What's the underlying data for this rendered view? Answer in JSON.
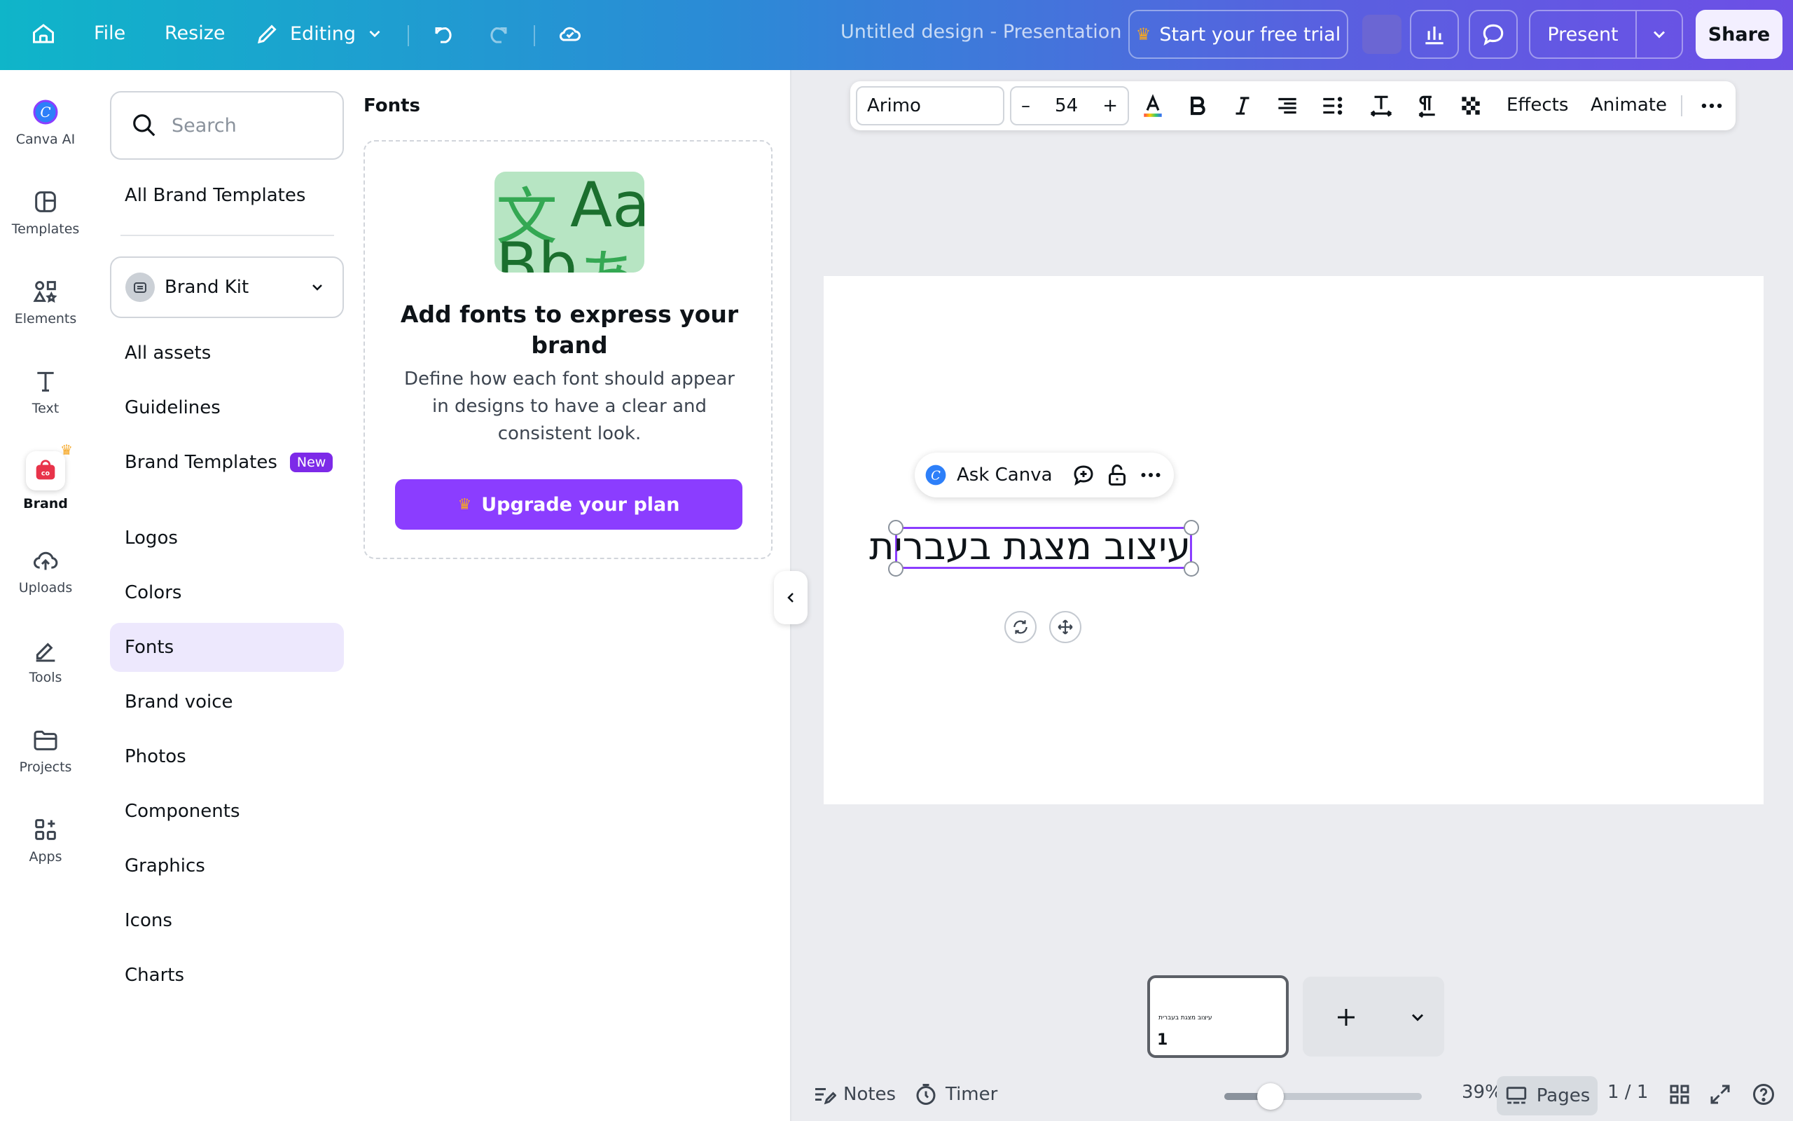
{
  "topbar": {
    "file": "File",
    "resize": "Resize",
    "editing": "Editing",
    "doc_title": "Untitled design - Presentation",
    "trial": "Start your free trial",
    "present": "Present",
    "share": "Share"
  },
  "rail": [
    {
      "label": "Canva AI",
      "icon": "canva-ai-icon"
    },
    {
      "label": "Templates",
      "icon": "templates-icon"
    },
    {
      "label": "Elements",
      "icon": "elements-icon"
    },
    {
      "label": "Text",
      "icon": "text-icon"
    },
    {
      "label": "Brand",
      "icon": "brand-icon"
    },
    {
      "label": "Uploads",
      "icon": "uploads-icon"
    },
    {
      "label": "Tools",
      "icon": "tools-icon"
    },
    {
      "label": "Projects",
      "icon": "projects-icon"
    },
    {
      "label": "Apps",
      "icon": "apps-icon"
    }
  ],
  "panel": {
    "search_placeholder": "Search",
    "all_brand_templates": "All Brand Templates",
    "brand_kit": "Brand Kit",
    "items": [
      "All assets",
      "Guidelines",
      "Brand Templates",
      "Logos",
      "Colors",
      "Fonts",
      "Brand voice",
      "Photos",
      "Components",
      "Graphics",
      "Icons",
      "Charts"
    ],
    "new_badge": "New",
    "fonts_heading": "Fonts",
    "card_title": "Add fonts to express your brand",
    "card_desc": "Define how each font should appear in designs to have a clear and consistent look.",
    "upgrade": "Upgrade your plan",
    "card_glyphs": [
      "文",
      "Aa",
      "Bb",
      "あ"
    ]
  },
  "format_bar": {
    "font": "Arimo",
    "minus": "–",
    "size": "54",
    "plus": "+",
    "effects": "Effects",
    "animate": "Animate"
  },
  "canvas": {
    "ask_canva": "Ask Canva",
    "text": "עיצוב מצגת בעברית"
  },
  "bottom": {
    "page_number": "1",
    "notes": "Notes",
    "timer": "Timer",
    "zoom": "39%",
    "zoom_level": 0.39,
    "pages": "Pages",
    "page_count": "1 / 1"
  },
  "colors": {
    "accent": "#8b3dff",
    "crown": "#f5a623"
  }
}
